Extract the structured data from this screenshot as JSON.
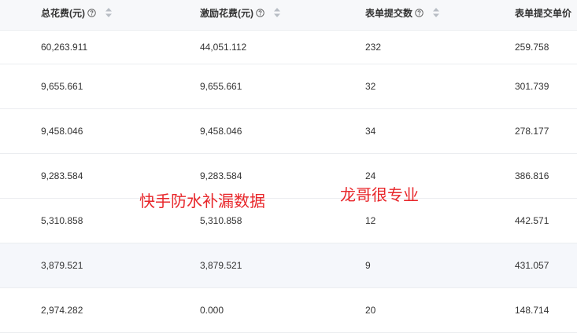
{
  "columns": [
    {
      "label": "总花费(元)",
      "help": true,
      "sortable": true
    },
    {
      "label": "激励花费(元)",
      "help": true,
      "sortable": true
    },
    {
      "label": "表单提交数",
      "help": true,
      "sortable": true
    },
    {
      "label": "表单提交单价",
      "help": false,
      "sortable": false
    }
  ],
  "rows": [
    {
      "total_cost": "60,263.911",
      "incentive_cost": "44,051.112",
      "form_submits": "232",
      "unit_price": "259.758"
    },
    {
      "total_cost": "9,655.661",
      "incentive_cost": "9,655.661",
      "form_submits": "32",
      "unit_price": "301.739"
    },
    {
      "total_cost": "9,458.046",
      "incentive_cost": "9,458.046",
      "form_submits": "34",
      "unit_price": "278.177"
    },
    {
      "total_cost": "9,283.584",
      "incentive_cost": "9,283.584",
      "form_submits": "24",
      "unit_price": "386.816"
    },
    {
      "total_cost": "5,310.858",
      "incentive_cost": "5,310.858",
      "form_submits": "12",
      "unit_price": "442.571"
    },
    {
      "total_cost": "3,879.521",
      "incentive_cost": "3,879.521",
      "form_submits": "9",
      "unit_price": "431.057"
    },
    {
      "total_cost": "2,974.282",
      "incentive_cost": "0.000",
      "form_submits": "20",
      "unit_price": "148.714"
    }
  ],
  "overlay": {
    "left_text": "快手防水补漏数据",
    "right_text": "龙哥很专业"
  },
  "colors": {
    "header_bg": "#f7f8fa",
    "row_alt_bg": "#f5f7fb",
    "divider": "#ebedf0",
    "text": "#333333",
    "icon": "#9aa0a6",
    "watermark": "#e8262a"
  }
}
